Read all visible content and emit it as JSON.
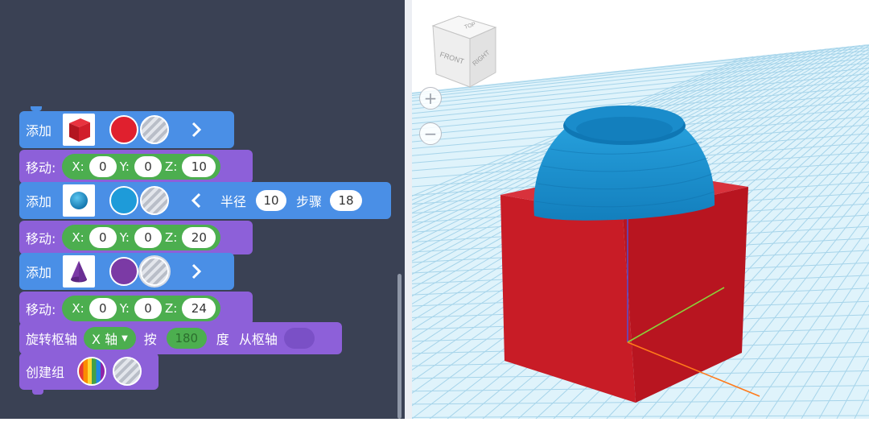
{
  "blocks": {
    "add1": {
      "label": "添加",
      "shape_icon": "red-box-icon",
      "color": "#e0202e",
      "color2": "#b8b8b8"
    },
    "move1": {
      "label": "移动:",
      "x_label": "X:",
      "y_label": "Y:",
      "z_label": "Z:",
      "x": "0",
      "y": "0",
      "z": "10"
    },
    "add2": {
      "label": "添加",
      "shape_icon": "blue-sphere-icon",
      "color": "#1e9bd9",
      "color2": "#b8b8b8",
      "radius_label": "半径",
      "radius": "10",
      "steps_label": "步骤",
      "steps": "18"
    },
    "move2": {
      "label": "移动:",
      "x_label": "X:",
      "y_label": "Y:",
      "z_label": "Z:",
      "x": "0",
      "y": "0",
      "z": "20"
    },
    "add3": {
      "label": "添加",
      "shape_icon": "purple-cone-icon",
      "color": "#7b3aa5",
      "color2": "#b8b8b8"
    },
    "move3": {
      "label": "移动:",
      "x_label": "X:",
      "y_label": "Y:",
      "z_label": "Z:",
      "x": "0",
      "y": "0",
      "z": "24"
    },
    "rotate": {
      "label": "旋转枢轴",
      "axis": "X 轴",
      "by_label": "按",
      "angle": "180",
      "unit_label": "度",
      "from_label": "从枢轴"
    },
    "group": {
      "label": "创建组"
    }
  },
  "viewcube": {
    "top": "TOP",
    "front": "FRONT",
    "right": "RIGHT"
  },
  "zoom": {
    "in": "+",
    "out": "−"
  },
  "colors": {
    "workspace": "#3a4154",
    "block_blue": "#4a8fe6",
    "block_purple": "#8d60d9",
    "input_green": "#4cae4f",
    "box_red": "#c81c26",
    "dome_blue": "#1c92d2",
    "grid_bg": "#dff3fb"
  }
}
